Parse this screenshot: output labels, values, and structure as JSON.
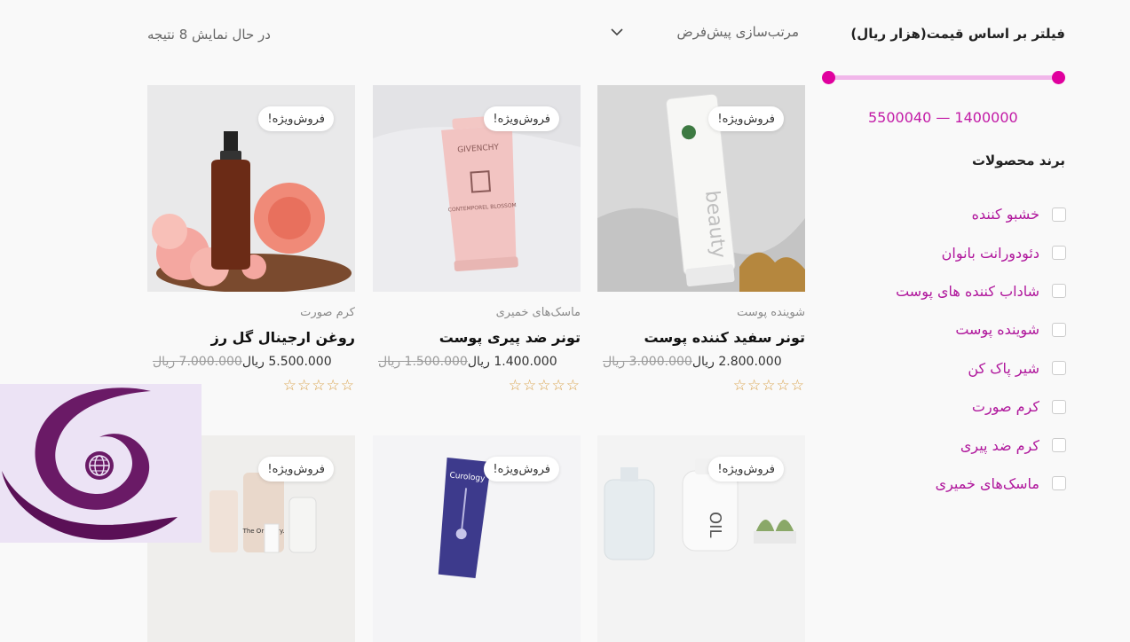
{
  "top": {
    "result_count": "در حال نمایش 8 نتیجه",
    "sort_label": "مرتب‌سازی پیش‌فرض"
  },
  "sidebar": {
    "filter_title": "فیلتر بر اساس قیمت(هزار ریال)",
    "price_range": "5500040 — 1400000",
    "brand_title": "برند محصولات",
    "brands": [
      {
        "label": "خشبو کننده"
      },
      {
        "label": "دئودورانت بانوان"
      },
      {
        "label": "شاداب کننده های پوست"
      },
      {
        "label": "شوینده پوست"
      },
      {
        "label": "شیر پاک کن"
      },
      {
        "label": "کرم صورت"
      },
      {
        "label": "کرم ضد پیری"
      },
      {
        "label": "ماسک‌های خمیری"
      }
    ]
  },
  "products": [
    {
      "badge": "فروش‌ویژه!",
      "category": "شوینده پوست",
      "title": "تونر سفید کننده پوست",
      "old_price": "3.000.000 ریال",
      "new_price": "2.800.000 ریال",
      "stars": "☆☆☆☆☆"
    },
    {
      "badge": "فروش‌ویژه!",
      "category": "ماسک‌های خمیری",
      "title": "تونر ضد پیری پوست",
      "old_price": "1.500.000 ریال",
      "new_price": "1.400.000 ریال",
      "stars": "☆☆☆☆☆"
    },
    {
      "badge": "فروش‌ویژه!",
      "category": "کرم صورت",
      "title": "روغن ارجینال گل رز",
      "old_price": "7.000.000 ریال",
      "new_price": "5.500.000 ریال",
      "stars": "☆☆☆☆☆"
    },
    {
      "badge": "فروش‌ویژه!"
    },
    {
      "badge": "فروش‌ویژه!"
    },
    {
      "badge": "فروش‌ویژه!"
    }
  ],
  "product_images": {
    "p1": "Curology",
    "p2": "The Ordinary.",
    "p3": "GIVENCHY",
    "p4": "CONTEMPOREL BLOSSOM",
    "p5": "beauty",
    "p6": "OIL"
  },
  "colors": {
    "accent": "#e0009e",
    "link": "#b0179c",
    "star": "#d9a14a"
  }
}
